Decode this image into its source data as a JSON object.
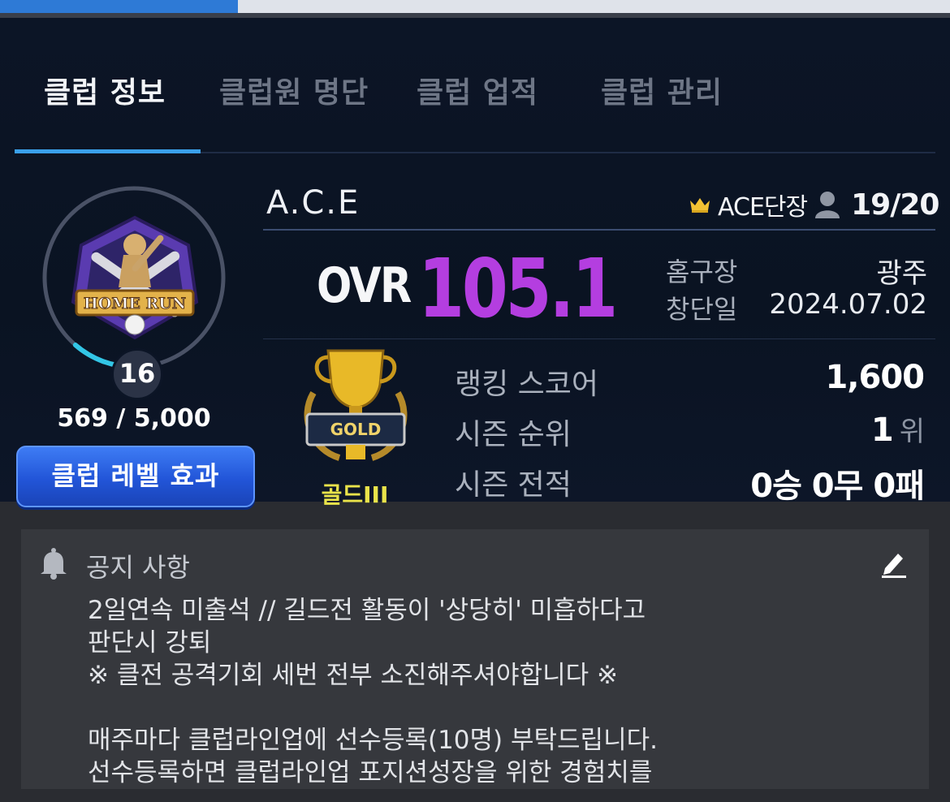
{
  "topbar": {
    "progress_fraction": 0.25
  },
  "tabs": [
    {
      "label": "클럽 정보",
      "active": true
    },
    {
      "label": "클럽원 명단",
      "active": false
    },
    {
      "label": "클럽 업적",
      "active": false
    },
    {
      "label": "클럽 관리",
      "active": false
    }
  ],
  "club": {
    "emblem_text": "HOME RUN",
    "level": "16",
    "xp_text": "569 / 5,000",
    "xp_fraction": 0.1138,
    "level_button": "클럽 레벨 효과",
    "name": "A.C.E",
    "leader": "ACE단장",
    "members": "19/20",
    "ovr_label": "OVR",
    "ovr_value": "105.1",
    "home_label": "홈구장",
    "home_value": "광주",
    "founded_label": "창단일",
    "founded_value": "2024.07.02"
  },
  "rank": {
    "tier_badge_text": "GOLD",
    "tier": "골드III",
    "score_label": "랭킹 스코어",
    "score_value": "1,600",
    "season_rank_label": "시즌 순위",
    "season_rank_value": "1",
    "season_rank_unit": "위",
    "record_label": "시즌 전적",
    "record_value": "0승 0무 0패"
  },
  "notice": {
    "title": "공지 사항",
    "body": "2일연속 미출석 // 길드전 활동이 '상당히' 미흡하다고\n판단시 강퇴\n※ 클전 공격기회 세번 전부 소진해주셔야합니다 ※\n\n매주마다 클럽라인업에 선수등록(10명) 부탁드립니다.\n선수등록하면 클럽라인업 포지션성장을 위한 경험치를"
  },
  "colors": {
    "accent_blue": "#3aa0ea",
    "ovr_purple": "#b43ee0",
    "tier_yellow": "#e9e34a",
    "crown_gold": "#f2c233"
  },
  "icons": [
    "crown-icon",
    "person-icon",
    "bell-icon",
    "edit-icon"
  ]
}
